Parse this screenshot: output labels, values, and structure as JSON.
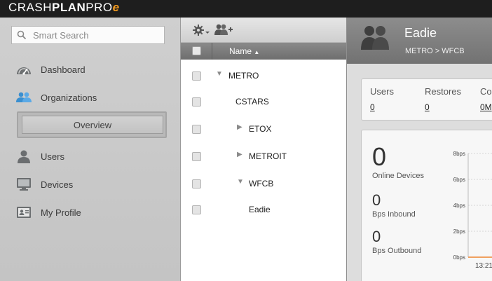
{
  "app": {
    "logo_thin": "CRASH",
    "logo_bold": "PLAN",
    "logo_pro": "PRO",
    "logo_e": "e"
  },
  "sidebar": {
    "search_placeholder": "Smart Search",
    "items": [
      {
        "label": "Dashboard",
        "icon": "dashboard-icon"
      },
      {
        "label": "Organizations",
        "icon": "organizations-icon"
      },
      {
        "label": "Overview",
        "icon": ""
      },
      {
        "label": "Users",
        "icon": "user-icon"
      },
      {
        "label": "Devices",
        "icon": "monitor-icon"
      },
      {
        "label": "My Profile",
        "icon": "profile-card-icon"
      }
    ]
  },
  "tree": {
    "column_name": "Name",
    "sort": "ascending",
    "rows": [
      {
        "name": "METRO",
        "twisty": "expanded"
      },
      {
        "name": "CSTARS",
        "twisty": "none"
      },
      {
        "name": "ETOX",
        "twisty": "collapsed"
      },
      {
        "name": "METROIT",
        "twisty": "collapsed"
      },
      {
        "name": "WFCB",
        "twisty": "expanded"
      },
      {
        "name": "Eadie",
        "twisty": "none"
      }
    ]
  },
  "detail": {
    "title": "Eadie",
    "breadcrumb": "METRO > WFCB",
    "stats": [
      {
        "label": "Users",
        "value": "0"
      },
      {
        "label": "Restores",
        "value": "0"
      },
      {
        "label": "Co",
        "value": "0M"
      }
    ],
    "metrics": [
      {
        "value": "0",
        "label": "Online Devices"
      },
      {
        "value": "0",
        "label": "Bps Inbound"
      },
      {
        "value": "0",
        "label": "Bps Outbound"
      }
    ]
  },
  "chart_data": {
    "type": "line",
    "y_ticks": [
      "8bps",
      "6bps",
      "4bps",
      "2bps",
      "0bps"
    ],
    "ylim": [
      0,
      8
    ],
    "x_ticks": [
      "13:21"
    ],
    "series": [
      {
        "values": [
          0,
          0,
          0
        ]
      }
    ],
    "grid": true
  },
  "colors": {
    "accent": "#f39a1f",
    "topbar": "#1e1e1e",
    "series_line": "#f0a060"
  }
}
